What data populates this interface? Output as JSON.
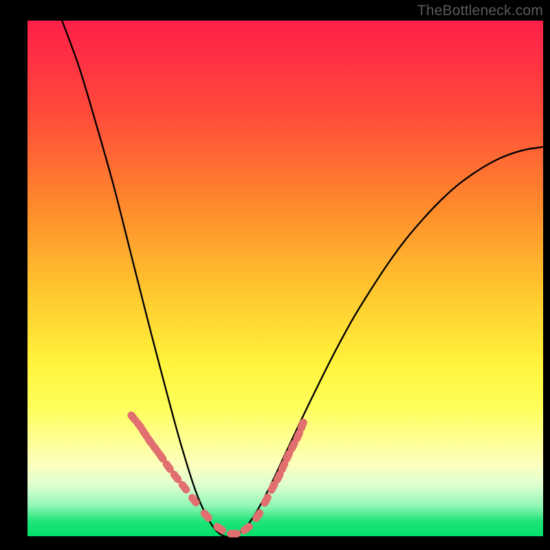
{
  "watermark": "TheBottleneck.com",
  "colors": {
    "curve_stroke": "#000000",
    "bead_fill": "#e26f6f",
    "gradient_stops": [
      "#ff1f49",
      "#ff4b3a",
      "#ff8a2c",
      "#ffc52e",
      "#fff23a",
      "#feff5a",
      "#fdffbd",
      "#dfffd0",
      "#94f7b8",
      "#22e47a",
      "#00e06b"
    ]
  },
  "chart_data": {
    "type": "line",
    "title": "",
    "xlabel": "",
    "ylabel": "",
    "xlim": [
      0,
      100
    ],
    "ylim": [
      0,
      100
    ],
    "y_axis_inverted": false,
    "notes": "Single V-shaped curve on a red→green vertical gradient. The minimum (curve touching the bottom / green zone) sits around x≈33–40. Pink capsule-shaped beads cluster along both arms of the curve in the lower ~25% of the plot. Values below are read off the pixel grid relative to the 750×750 plot area and normalised to 0–100; y=0 is the bottom edge.",
    "series": [
      {
        "name": "curve",
        "kind": "line",
        "x": [
          6.7,
          10.0,
          13.3,
          16.7,
          20.0,
          23.3,
          26.7,
          30.0,
          33.3,
          36.7,
          40.0,
          43.3,
          46.7,
          50.0,
          53.3,
          56.7,
          60.0,
          63.3,
          66.7,
          70.0,
          73.3,
          76.7,
          80.0,
          83.3,
          86.7,
          90.0,
          93.3,
          96.7,
          100.0
        ],
        "y": [
          100.0,
          91.0,
          80.0,
          68.0,
          55.0,
          42.0,
          29.0,
          17.0,
          7.0,
          1.0,
          0.0,
          3.0,
          9.0,
          16.0,
          23.0,
          30.0,
          36.5,
          42.5,
          48.0,
          53.0,
          57.5,
          61.5,
          65.0,
          68.0,
          70.5,
          72.5,
          74.0,
          75.0,
          75.5
        ]
      },
      {
        "name": "beads",
        "kind": "markers",
        "x": [
          20.5,
          21.7,
          22.7,
          23.7,
          24.8,
          25.9,
          27.3,
          28.8,
          30.4,
          32.3,
          34.7,
          37.3,
          40.0,
          42.5,
          44.7,
          46.3,
          47.6,
          48.7,
          49.6,
          50.5,
          51.5,
          52.5,
          53.3
        ],
        "y": [
          23.0,
          21.5,
          20.0,
          18.5,
          17.0,
          15.5,
          13.5,
          11.5,
          9.5,
          7.0,
          4.0,
          1.5,
          0.5,
          1.5,
          4.0,
          7.0,
          9.5,
          11.5,
          13.5,
          15.5,
          17.5,
          19.5,
          21.5
        ]
      }
    ]
  }
}
